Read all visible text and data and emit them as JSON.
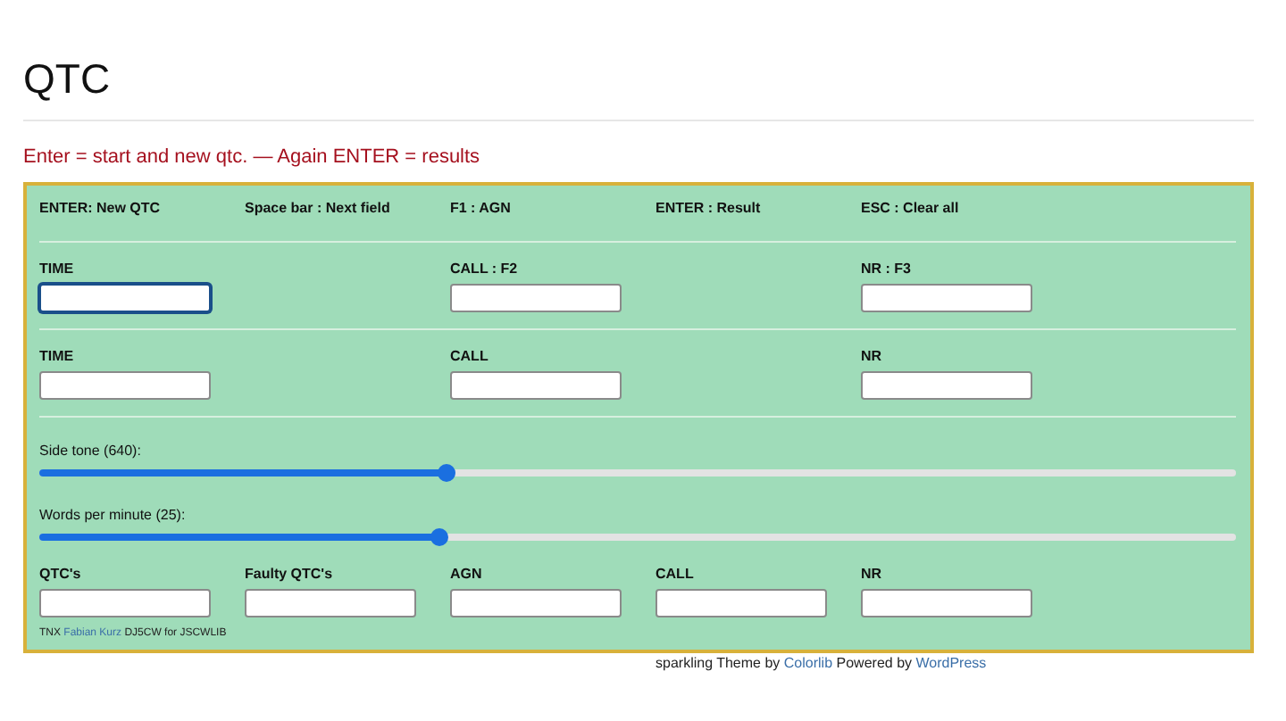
{
  "heading": "QTC",
  "hint": "Enter = start and new qtc. — Again ENTER = results",
  "shortcuts": [
    "ENTER: New QTC",
    "Space bar : Next field",
    "F1 : AGN",
    "ENTER : Result",
    "ESC : Clear all"
  ],
  "field_rows": [
    [
      {
        "label": "TIME",
        "focused": true
      },
      {
        "label": "CALL : F2",
        "focused": false
      },
      {
        "label": "NR : F3",
        "focused": false
      }
    ],
    [
      {
        "label": "TIME",
        "focused": false
      },
      {
        "label": "CALL",
        "focused": false
      },
      {
        "label": "NR",
        "focused": false
      }
    ]
  ],
  "sliders": [
    {
      "label": "Side tone (640):",
      "level": 0.34
    },
    {
      "label": "Words per minute (25):",
      "level": 0.335
    }
  ],
  "counters": [
    {
      "label": "QTC's"
    },
    {
      "label": "Faulty QTC's"
    },
    {
      "label": "AGN"
    },
    {
      "label": "CALL"
    },
    {
      "label": "NR"
    }
  ],
  "credit": {
    "prefix": "TNX",
    "link": "Fabian Kurz",
    "suffix": "DJ5CW for JSCWLIB"
  },
  "footer": {
    "text": "sparkling Theme by",
    "link": "Colorlib",
    "text_2": "Powered by",
    "link_2": "WordPress"
  }
}
